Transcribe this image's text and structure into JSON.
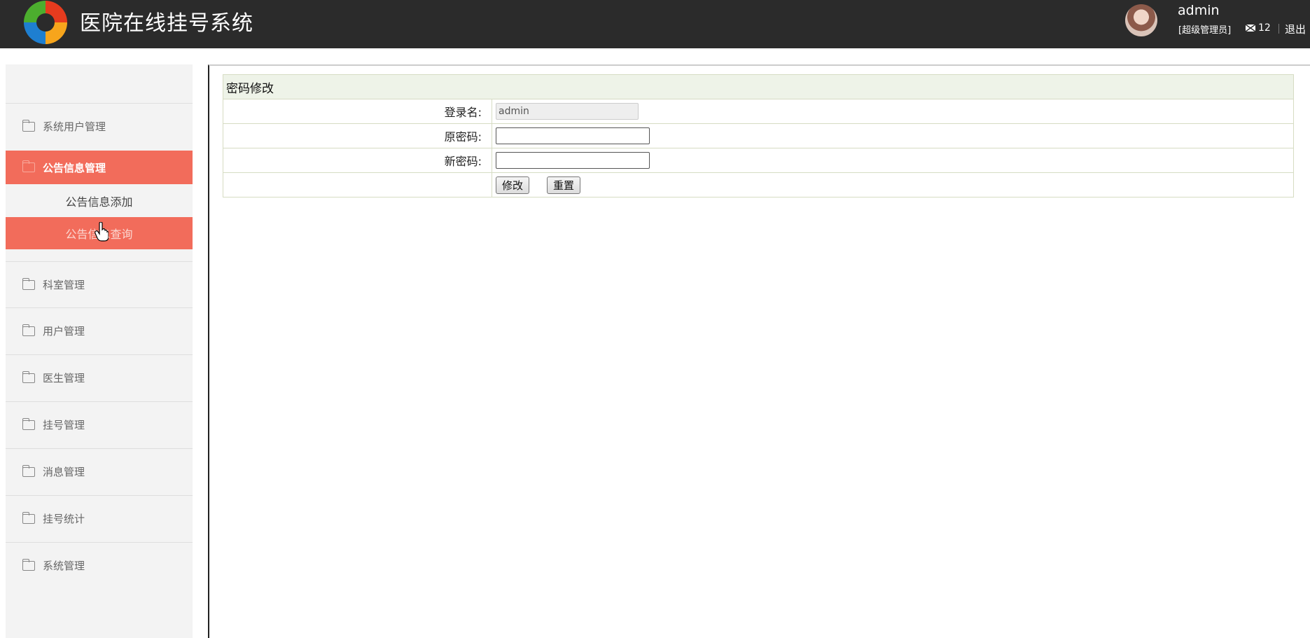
{
  "header": {
    "title": "医院在线挂号系统",
    "user_name": "admin",
    "user_role": "[超级管理员]",
    "message_count": "12",
    "logout_label": "退出"
  },
  "sidebar": {
    "items": [
      {
        "label": "系统用户管理"
      },
      {
        "label": "公告信息管理",
        "active": true
      },
      {
        "label": "科室管理"
      },
      {
        "label": "用户管理"
      },
      {
        "label": "医生管理"
      },
      {
        "label": "挂号管理"
      },
      {
        "label": "消息管理"
      },
      {
        "label": "挂号统计"
      },
      {
        "label": "系统管理"
      }
    ],
    "sub_items": [
      {
        "label": "公告信息添加"
      },
      {
        "label": "公告信息查询",
        "active": true
      }
    ]
  },
  "form": {
    "caption": "密码修改",
    "login_label": "登录名:",
    "login_value": "admin",
    "old_pw_label": "原密码:",
    "new_pw_label": "新密码:",
    "submit_label": "修改",
    "reset_label": "重置"
  },
  "colors": {
    "header_bg": "#2b2b2b",
    "accent": "#f26c5b",
    "sidebar_bg": "#f3f3f3",
    "caption_bg": "#eef3e8"
  }
}
